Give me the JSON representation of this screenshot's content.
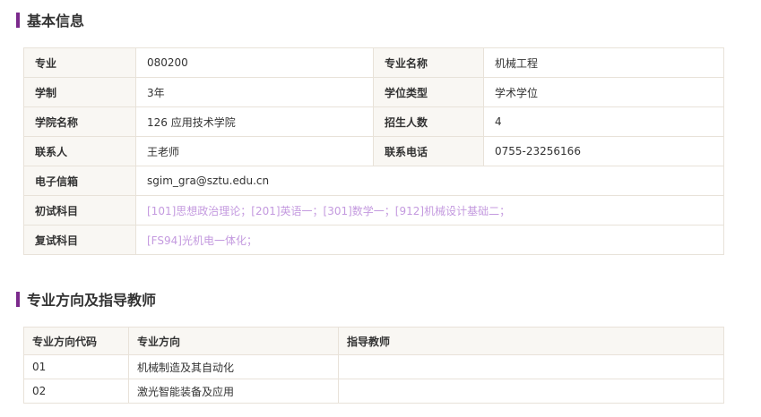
{
  "theme": {
    "accent": "#7b2a8c",
    "label_bg": "#f9f7f3",
    "border": "#e8e2d9",
    "link_color": "#c49adf"
  },
  "basic_info": {
    "title": "基本信息",
    "major_label": "专业",
    "major_code": "080200",
    "major_name_label": "专业名称",
    "major_name": "机械工程",
    "duration_label": "学制",
    "duration": "3年",
    "degree_type_label": "学位类型",
    "degree_type": "学术学位",
    "college_label": "学院名称",
    "college": "126 应用技术学院",
    "enrollment_label": "招生人数",
    "enrollment": "4",
    "contact_label": "联系人",
    "contact": "王老师",
    "phone_label": "联系电话",
    "phone": "0755-23256166",
    "email_label": "电子信箱",
    "email": "sgim_gra@sztu.edu.cn",
    "prelim_label": "初试科目",
    "prelim_subjects": "[101]思想政治理论；[201]英语一；[301]数学一；[912]机械设计基础二；",
    "retest_label": "复试科目",
    "retest_subjects": "[FS94]光机电一体化；"
  },
  "directions": {
    "title": "专业方向及指导教师",
    "headers": [
      "专业方向代码",
      "专业方向",
      "指导教师"
    ],
    "rows": [
      {
        "code": "01",
        "name": "机械制造及其自动化",
        "advisor": ""
      },
      {
        "code": "02",
        "name": "激光智能装备及应用",
        "advisor": ""
      }
    ]
  }
}
